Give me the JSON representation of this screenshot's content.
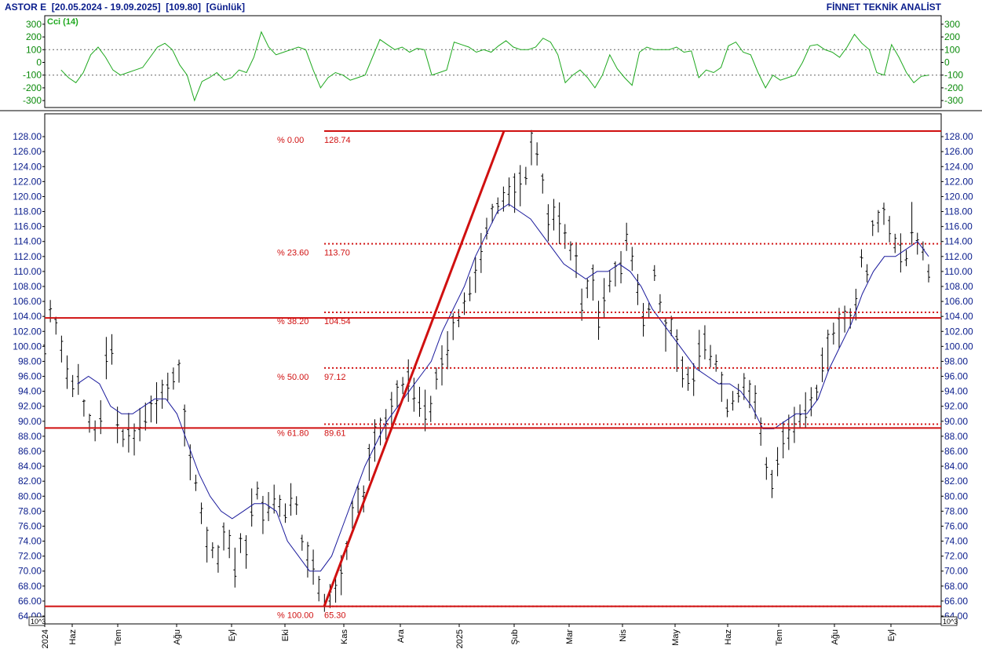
{
  "header": {
    "title": "ASTOR E",
    "range": "[20.05.2024 - 19.09.2025]",
    "last": "[109.80]",
    "period": "[Günlük]",
    "brand": "FİNNET TEKNİK ANALİST"
  },
  "colors": {
    "price_bars": "#000000",
    "moving_average": "#1a1a9c",
    "cci_line": "#1ea81e",
    "fib_lines": "#d01010",
    "axis_text": "#0a1d8c"
  },
  "chart_data": [
    {
      "type": "line",
      "panel": "indicator",
      "title": "Cci (14)",
      "ylim": [
        -330,
        330
      ],
      "y_ticks": [
        "300",
        "200",
        "100",
        "0",
        "-100",
        "-200",
        "-300"
      ],
      "reference_lines": [
        100,
        -100
      ],
      "grid": false,
      "series": [
        {
          "name": "Cci (14)",
          "x_range": [
            "2024-05-29",
            "2025-09-19"
          ],
          "values": [
            -60,
            -120,
            -160,
            -80,
            60,
            120,
            40,
            -60,
            -100,
            -80,
            -60,
            -40,
            40,
            120,
            150,
            100,
            -20,
            -100,
            -300,
            -150,
            -120,
            -80,
            -140,
            -120,
            -60,
            -80,
            40,
            240,
            120,
            60,
            80,
            100,
            120,
            100,
            -60,
            -200,
            -120,
            -80,
            -100,
            -140,
            -120,
            -100,
            40,
            180,
            140,
            100,
            120,
            80,
            110,
            100,
            -100,
            -80,
            -60,
            160,
            140,
            120,
            80,
            100,
            80,
            130,
            170,
            120,
            100,
            100,
            120,
            190,
            160,
            60,
            -160,
            -100,
            -60,
            -120,
            -200,
            -100,
            60,
            -50,
            -120,
            -180,
            80,
            120,
            100,
            100,
            100,
            120,
            80,
            90,
            -120,
            -60,
            -80,
            -40,
            130,
            160,
            80,
            60,
            -80,
            -200,
            -100,
            -140,
            -120,
            -100,
            0,
            130,
            140,
            100,
            80,
            40,
            120,
            220,
            150,
            100,
            -80,
            -100,
            140,
            40,
            -80,
            -160,
            -110,
            -100
          ]
        }
      ]
    },
    {
      "type": "bar",
      "subtype": "ohlc",
      "panel": "price",
      "ylim": [
        64,
        130
      ],
      "y_ticks": [
        "128.00",
        "126.00",
        "124.00",
        "122.00",
        "120.00",
        "118.00",
        "116.00",
        "114.00",
        "112.00",
        "110.00",
        "108.00",
        "106.00",
        "104.00",
        "102.00",
        "100.00",
        "98.00",
        "96.00",
        "94.00",
        "92.00",
        "90.00",
        "88.00",
        "86.00",
        "84.00",
        "82.00",
        "80.00",
        "78.00",
        "76.00",
        "74.00",
        "72.00",
        "70.00",
        "68.00",
        "66.00",
        "64.00"
      ],
      "x_ticks": [
        "2024",
        "Haz",
        "Tem",
        "Ağu",
        "Eyl",
        "Eki",
        "Kas",
        "Ara",
        "2025",
        "Şub",
        "Mar",
        "Nis",
        "May",
        "Haz",
        "Tem",
        "Ağu",
        "Eyl"
      ],
      "exponent_label": "10^3",
      "grid": false,
      "series": [
        {
          "name": "price",
          "x_range": [
            "2024-05-20",
            "2025-09-19"
          ],
          "values": [
            100,
            105,
            103,
            100,
            97,
            95,
            96,
            92,
            90,
            89,
            91,
            99,
            100,
            90,
            88,
            89,
            88,
            90,
            91,
            92,
            93,
            94,
            95,
            96,
            97,
            90,
            85,
            82,
            78,
            74,
            73,
            72,
            75,
            74,
            71,
            74,
            73,
            79,
            81,
            78,
            79,
            80,
            79,
            78,
            80,
            79,
            74,
            72,
            71,
            68,
            66,
            67,
            68,
            70,
            73,
            78,
            80,
            80,
            85,
            88,
            89,
            90,
            92,
            94,
            95,
            96,
            94,
            93,
            92,
            92,
            96,
            98,
            100,
            103,
            104,
            106,
            108,
            110,
            113,
            116,
            118,
            119,
            120,
            121,
            121,
            122,
            123,
            127,
            126,
            122,
            117,
            118,
            117,
            115,
            113,
            112,
            106,
            108,
            109,
            104,
            107,
            109,
            110,
            111,
            115,
            112,
            108,
            104,
            105,
            110,
            106,
            102,
            103,
            100,
            97,
            96,
            96,
            100,
            101,
            99,
            98,
            95,
            92,
            93,
            94,
            95,
            94,
            93,
            89,
            84,
            82,
            85,
            88,
            89,
            90,
            91,
            92,
            93,
            94,
            98,
            100,
            102,
            103,
            104,
            104,
            106,
            112,
            110,
            116,
            117,
            118,
            116,
            114,
            113,
            112,
            117,
            114,
            113,
            110
          ]
        },
        {
          "name": "moving average",
          "x_range": [
            "2024-06-07",
            "2025-09-19"
          ],
          "values": [
            95,
            96,
            95,
            92,
            91,
            91,
            92,
            93,
            93,
            91,
            87,
            83,
            80,
            78,
            77,
            78,
            79,
            79,
            78,
            74,
            72,
            70,
            70,
            72,
            76,
            80,
            84,
            87,
            90,
            92,
            94,
            96,
            98,
            102,
            105,
            108,
            112,
            115,
            118,
            119,
            118,
            117,
            115,
            113,
            111,
            110,
            109,
            110,
            110,
            111,
            110,
            108,
            105,
            103,
            101,
            99,
            97,
            96,
            95,
            95,
            94,
            92,
            89,
            89,
            90,
            91,
            91,
            93,
            97,
            100,
            103,
            107,
            110,
            112,
            112,
            113,
            114,
            112
          ]
        }
      ],
      "trend_line": {
        "from": {
          "x": "2024-10-21",
          "y": 65.3
        },
        "to": {
          "x": "2025-01-28",
          "y": 128.74
        }
      },
      "fibonacci": [
        {
          "label": "% 0.00",
          "value": "128.74",
          "level": 128.74
        },
        {
          "label": "% 23.60",
          "value": "113.70",
          "level": 113.7
        },
        {
          "label": "% 38.20",
          "value": "104.54",
          "level": 104.54
        },
        {
          "label": "% 50.00",
          "value": "97.12",
          "level": 97.12
        },
        {
          "label": "% 61.80",
          "value": "89.61",
          "level": 89.61
        },
        {
          "label": "% 100.00",
          "value": "65.30",
          "level": 65.3
        }
      ],
      "horizontal_lines": [
        128.74,
        103.8,
        89.1,
        65.3
      ]
    }
  ]
}
